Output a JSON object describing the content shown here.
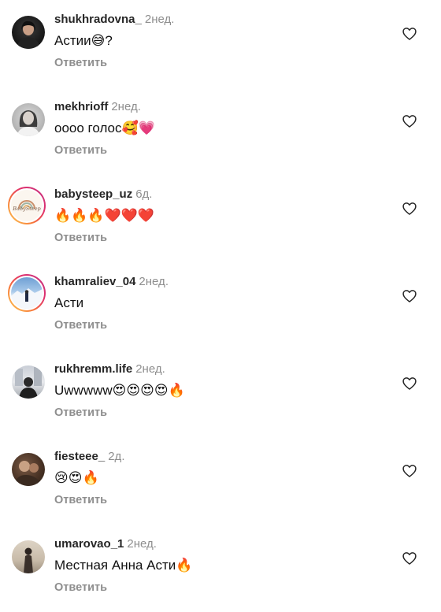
{
  "comments": [
    {
      "username": "shukhradovna_",
      "time": "2нед.",
      "text": "Астии😅?",
      "reply": "Ответить",
      "avatar": "dark-portrait-avatar"
    },
    {
      "username": "mekhrioff",
      "time": "2нед.",
      "text": "оооо голос🥰💗",
      "reply": "Ответить",
      "avatar": "light-portrait-avatar"
    },
    {
      "username": "babysteep_uz",
      "time": "6д.",
      "text": "🔥🔥🔥❤️❤️❤️",
      "reply": "Ответить",
      "avatar": "babysteep-logo-avatar",
      "logo_text": "BabySteep"
    },
    {
      "username": "khamraliev_04",
      "time": "2нед.",
      "text": "Асти",
      "reply": "Ответить",
      "avatar": "snow-landscape-avatar"
    },
    {
      "username": "rukhremm.life",
      "time": "2нед.",
      "text": "Uwwwww😍😍😍😍🔥",
      "reply": "Ответить",
      "avatar": "city-portrait-avatar"
    },
    {
      "username": "fiesteee_",
      "time": "2д.",
      "text": "😢😍🔥",
      "reply": "Ответить",
      "avatar": "warm-portrait-avatar"
    },
    {
      "username": "umarovao_1",
      "time": "2нед.",
      "text": "Местная Анна Асти🔥",
      "reply": "Ответить",
      "avatar": "beige-portrait-avatar"
    }
  ],
  "icons": {
    "like": "heart-outline-icon"
  },
  "colors": {
    "username": "#262626",
    "muted": "#8e8e8e",
    "story_ring_start": "#fdd35a",
    "story_ring_end": "#c13584"
  }
}
